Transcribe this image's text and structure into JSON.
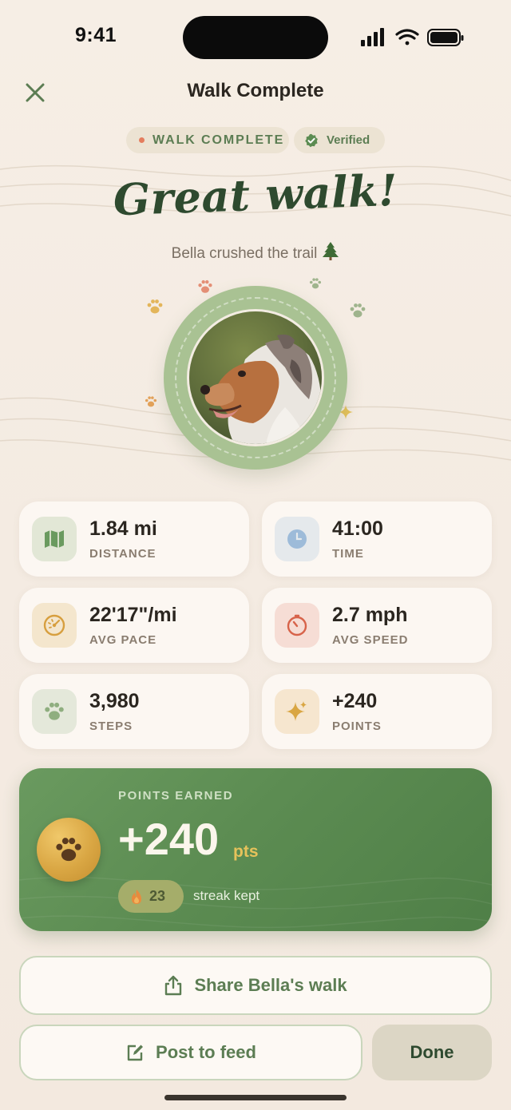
{
  "status_bar": {
    "time": "9:41"
  },
  "header": {
    "title": "Walk Complete"
  },
  "chips": {
    "walk_complete": "WALK COMPLETE",
    "verified": "Verified"
  },
  "hero": {
    "headline": "Great walk!",
    "subline": "Bella crushed the trail"
  },
  "stats": [
    {
      "value": "1.84 mi",
      "label": "DISTANCE",
      "icon": "map-icon"
    },
    {
      "value": "41:00",
      "label": "TIME",
      "icon": "clock-icon"
    },
    {
      "value": "22'17\"/mi",
      "label": "AVG PACE",
      "icon": "pace-gauge-icon"
    },
    {
      "value": "2.7 mph",
      "label": "AVG SPEED",
      "icon": "speedometer-icon"
    },
    {
      "value": "3,980",
      "label": "STEPS",
      "icon": "paw-icon"
    },
    {
      "value": "+240",
      "label": "POINTS",
      "icon": "sparkle-icon"
    }
  ],
  "points_card": {
    "label": "POINTS EARNED",
    "value": "+240",
    "unit": "pts",
    "streak_count": "23",
    "streak_text": "streak kept"
  },
  "buttons": {
    "share": "Share Bella's walk",
    "post": "Post to feed",
    "done": "Done"
  },
  "colors": {
    "accent_green": "#5c7d53",
    "banner_green": "#5c8c52",
    "gold": "#e6c25b",
    "background": "#f6eee5"
  }
}
